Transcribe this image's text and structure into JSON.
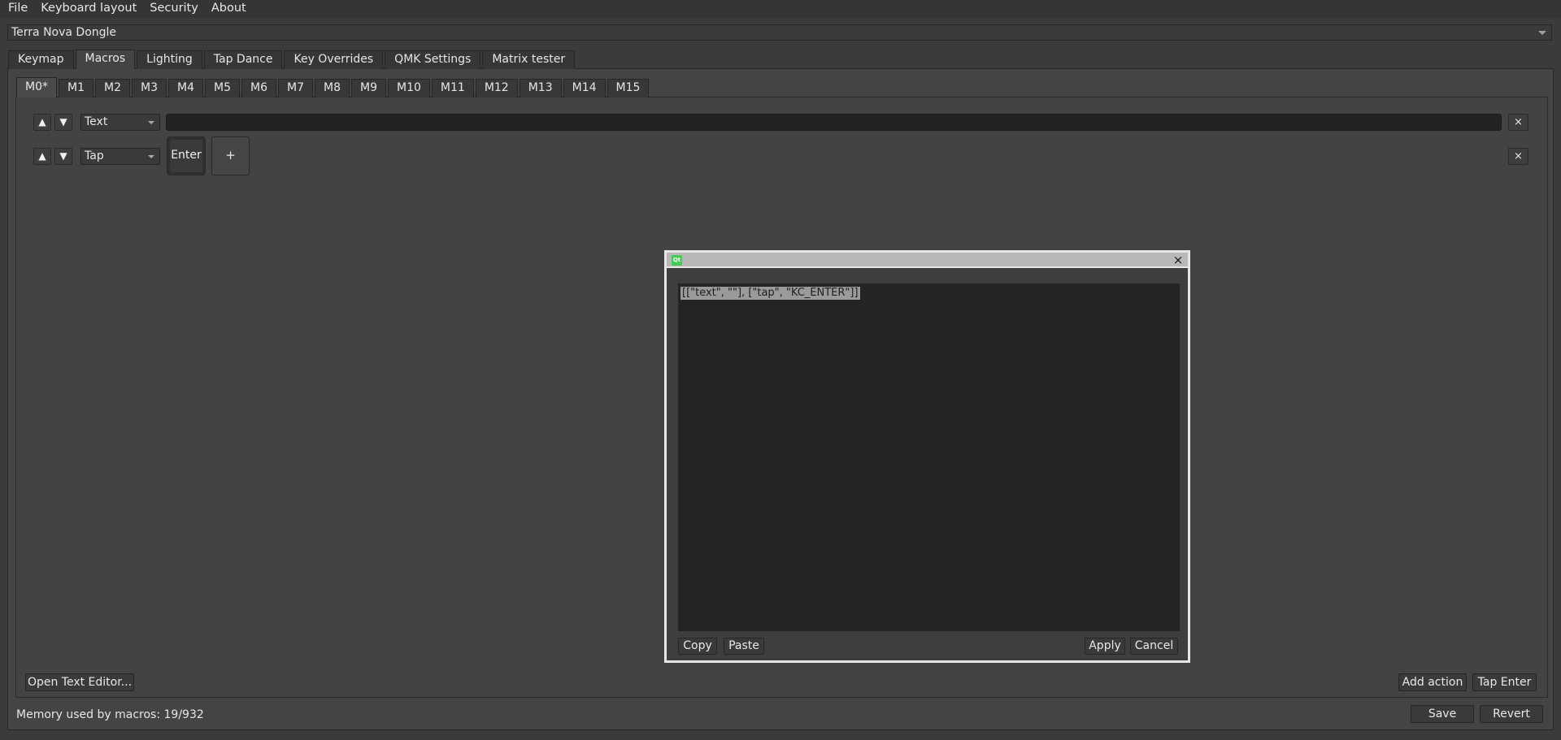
{
  "menu": [
    "File",
    "Keyboard layout",
    "Security",
    "About"
  ],
  "device": {
    "selected": "Terra Nova Dongle"
  },
  "tabs": [
    "Keymap",
    "Macros",
    "Lighting",
    "Tap Dance",
    "Key Overrides",
    "QMK Settings",
    "Matrix tester"
  ],
  "active_tab": "Macros",
  "macro_tabs": [
    "M0*",
    "M1",
    "M2",
    "M3",
    "M4",
    "M5",
    "M6",
    "M7",
    "M8",
    "M9",
    "M10",
    "M11",
    "M12",
    "M13",
    "M14",
    "M15"
  ],
  "active_macro_tab": "M0*",
  "actions": [
    {
      "type": "Text",
      "value": ""
    },
    {
      "type": "Tap",
      "keys": [
        "Enter"
      ]
    }
  ],
  "icons": {
    "up": "▲",
    "down": "▼",
    "close": "×",
    "plus": "+"
  },
  "buttons": {
    "open_text_editor": "Open Text Editor...",
    "add_action": "Add action",
    "tap_enter": "Tap Enter",
    "save": "Save",
    "revert": "Revert"
  },
  "status": "Memory used by macros: 19/932",
  "dialog": {
    "icon_label": "Qt",
    "close": "×",
    "text": "[[\"text\", \"\"], [\"tap\", \"KC_ENTER\"]]",
    "copy": "Copy",
    "paste": "Paste",
    "apply": "Apply",
    "cancel": "Cancel"
  }
}
